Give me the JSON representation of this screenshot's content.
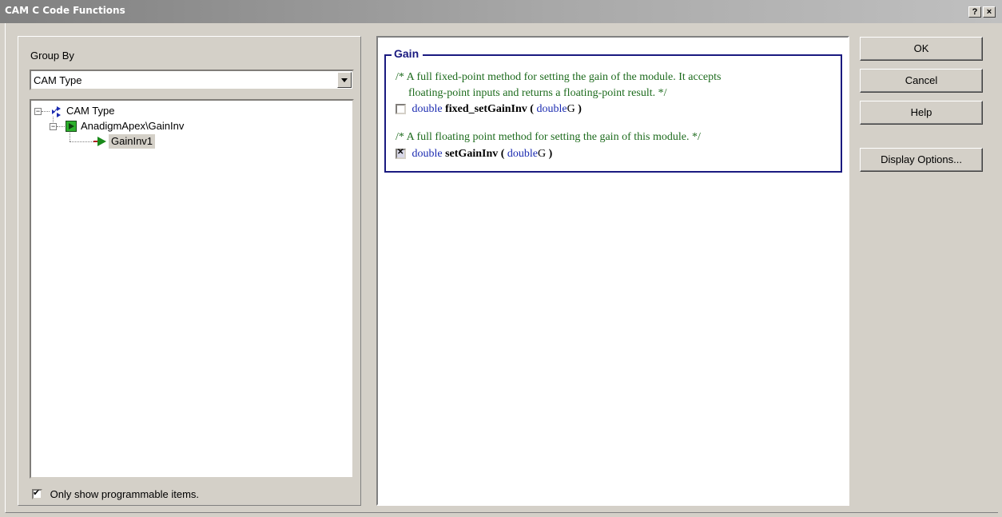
{
  "window": {
    "title": "CAM C Code Functions",
    "help_btn": "?",
    "close_btn": "×"
  },
  "left": {
    "groupby_label": "Group By",
    "groupby_value": "CAM Type",
    "tree": [
      {
        "label": "CAM Type",
        "expander": "−"
      },
      {
        "label": "AnadigmApex\\GainInv",
        "expander": "−"
      },
      {
        "label": "GainInv1"
      }
    ],
    "only_programmable_label": "Only show programmable items."
  },
  "gain": {
    "title": "Gain",
    "fn1_comment_l1": "/* A full fixed-point method for setting the gain of the module. It accepts",
    "fn1_comment_l2": "floating-point inputs and returns a floating-point result.  */",
    "fn1": {
      "ret": "double",
      "name": "fixed_setGainInv",
      "open": "(",
      "ptype": "double",
      "pname": "G",
      "close": ")"
    },
    "fn2_comment": "/* A full floating point method for setting the gain of this module.  */",
    "fn2": {
      "ret": "double",
      "name": "setGainInv",
      "open": "(",
      "ptype": "double",
      "pname": "G",
      "close": ")"
    }
  },
  "buttons": {
    "ok": "OK",
    "cancel": "Cancel",
    "help": "Help",
    "display_options": "Display Options..."
  }
}
